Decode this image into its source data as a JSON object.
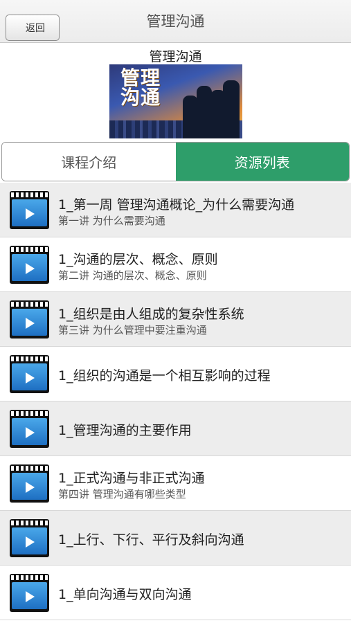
{
  "header": {
    "title": "管理沟通",
    "back_label": "返回"
  },
  "course": {
    "title": "管理沟通",
    "banner_text_line1": "管理",
    "banner_text_line2": "沟通"
  },
  "tabs": [
    {
      "label": "课程介绍",
      "active": false
    },
    {
      "label": "资源列表",
      "active": true
    }
  ],
  "colors": {
    "active_tab": "#2e9e6a",
    "row_alt": "#ededed",
    "video_icon": "#2a82d6"
  },
  "resources": [
    {
      "title": "1_第一周 管理沟通概论_为什么需要沟通",
      "subtitle": "第一讲 为什么需要沟通"
    },
    {
      "title": "1_沟通的层次、概念、原则",
      "subtitle": "第二讲 沟通的层次、概念、原则"
    },
    {
      "title": "1_组织是由人组成的复杂性系统",
      "subtitle": "第三讲 为什么管理中要注重沟通"
    },
    {
      "title": "1_组织的沟通是一个相互影响的过程",
      "subtitle": ""
    },
    {
      "title": "1_管理沟通的主要作用",
      "subtitle": ""
    },
    {
      "title": "1_正式沟通与非正式沟通",
      "subtitle": "第四讲 管理沟通有哪些类型"
    },
    {
      "title": "1_上行、下行、平行及斜向沟通",
      "subtitle": ""
    },
    {
      "title": "1_单向沟通与双向沟通",
      "subtitle": ""
    }
  ]
}
